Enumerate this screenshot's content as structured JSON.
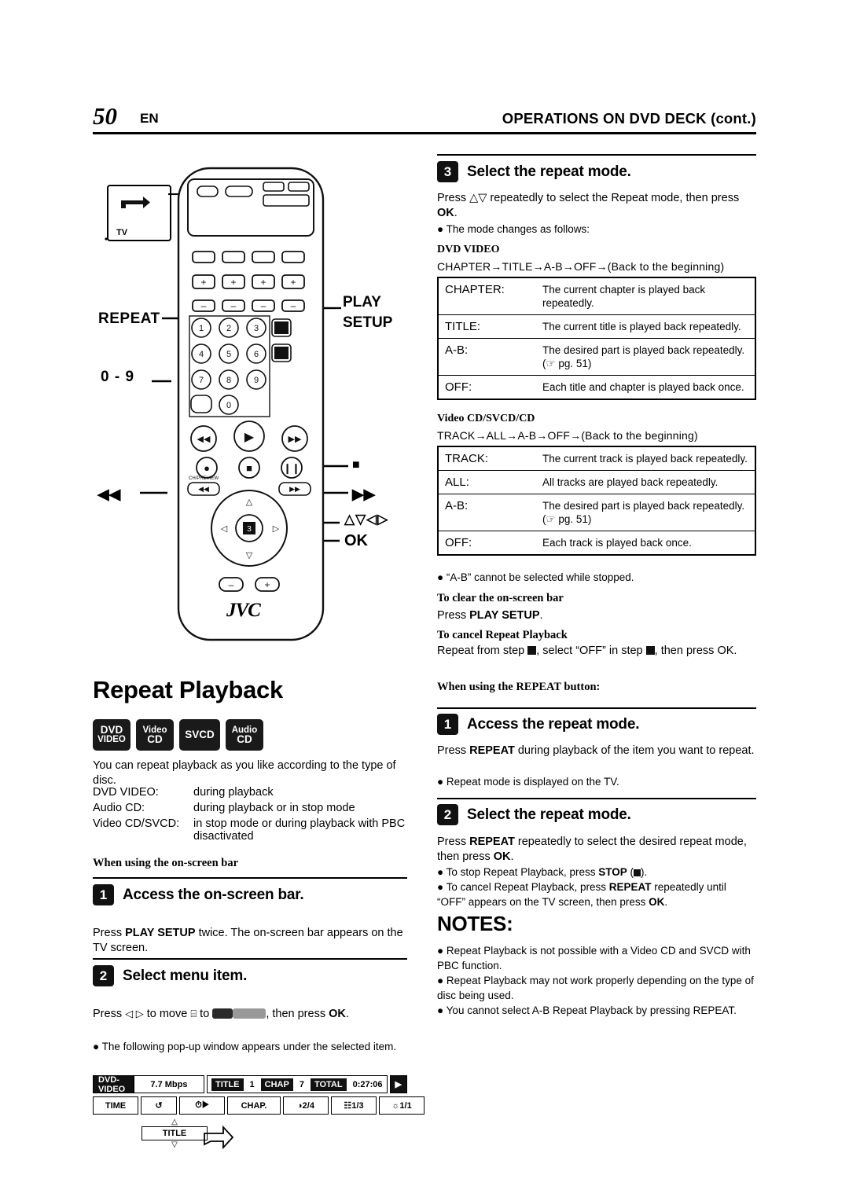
{
  "header": {
    "page_number": "50",
    "page_lang": "EN",
    "title": "OPERATIONS ON DVD DECK (cont.)"
  },
  "remote": {
    "tv_label": "TV",
    "repeat_label": "REPEAT",
    "play_label": "PLAY",
    "setup_label": "SETUP",
    "numeric_label": "0 - 9",
    "arrows_label": "△▽◁▷",
    "ok_label": "OK",
    "brand": "JVC",
    "keys": [
      "1",
      "2",
      "3",
      "4",
      "5",
      "6",
      "7",
      "8",
      "9",
      "0"
    ],
    "preview_label": "CH/PREVIEW"
  },
  "left": {
    "section_title": "Repeat Playback",
    "disc_badges": [
      {
        "l1": "DVD",
        "l2": "VIDEO"
      },
      {
        "l1": "Video",
        "l2": "CD"
      },
      {
        "l1": "SVCD",
        "l2": ""
      },
      {
        "l1": "Audio",
        "l2": "CD"
      }
    ],
    "intro": "You can repeat playback as you like according to the type of disc.",
    "disc_list": [
      {
        "term": "DVD VIDEO:",
        "desc": "during playback"
      },
      {
        "term": "Audio CD:",
        "desc": "during playback or in stop mode"
      },
      {
        "term": "Video CD/SVCD:",
        "desc": "in stop mode or during playback with PBC disactivated"
      }
    ],
    "subhead_onscreen": "When using the on-screen bar",
    "step1": {
      "num": "1",
      "title": "Access the on-screen bar.",
      "body": "Press PLAY SETUP twice. The on-screen bar appears on the TV screen."
    },
    "step2": {
      "num": "2",
      "title": "Select menu item.",
      "body_pre": "Press ",
      "body_arrows": "◁ ▷",
      "body_mid": " to move ",
      "body_cursor": "⬚",
      "body_to": " to ",
      "body_post": ", then press OK.",
      "bullet": "The following pop-up window appears under the selected item."
    },
    "onscreen_bar": {
      "label_dvdvideo": "DVD-VIDEO",
      "bitrate": "7.7 Mbps",
      "title_key": "TITLE",
      "title_val": "1",
      "chap_key": "CHAP",
      "chap_val": "7",
      "total_key": "TOTAL",
      "total_val": "0:27:06",
      "time_key": "TIME",
      "chap_btn": "CHAP.",
      "audio": "2/4",
      "subtitle": "1/3",
      "angle": "1/1",
      "popup": "TITLE"
    }
  },
  "right": {
    "step3": {
      "num": "3",
      "title": "Select the repeat mode.",
      "body": "Press △▽ repeatedly to select the Repeat mode, then press OK.",
      "bullet": "The mode changes as follows:"
    },
    "dvd_video_head": "DVD VIDEO",
    "dvd_video_flow": "CHAPTER→TITLE→A-B→OFF→(Back to the beginning)",
    "dvd_table": [
      {
        "k": "CHAPTER:",
        "v": "The current chapter is played back repeatedly."
      },
      {
        "k": "TITLE:",
        "v": "The current title is played back repeatedly."
      },
      {
        "k": "A-B:",
        "v": "The desired part is played back repeatedly. (☞ pg. 51)"
      },
      {
        "k": "OFF:",
        "v": "Each title and chapter is played back once."
      }
    ],
    "vcd_head": "Video CD/SVCD/CD",
    "vcd_flow": "TRACK→ALL→A-B→OFF→(Back to the beginning)",
    "vcd_table": [
      {
        "k": "TRACK:",
        "v": "The current track is played back repeatedly."
      },
      {
        "k": "ALL:",
        "v": "All tracks are played back repeatedly."
      },
      {
        "k": "A-B:",
        "v": "The desired part is played back repeatedly. (☞ pg. 51)"
      },
      {
        "k": "OFF:",
        "v": "Each track is played back once."
      }
    ],
    "bullet_ab": "“A-B” cannot be selected while stopped.",
    "clear_head": "To clear the on-screen bar",
    "clear_body": "Press PLAY SETUP.",
    "cancel_head": "To cancel Repeat Playback",
    "cancel_body_pre": "Repeat from step ",
    "cancel_step1": "1",
    "cancel_body_mid": ", select “OFF” in step ",
    "cancel_step3": "3",
    "cancel_body_post": ", then press OK.",
    "repeat_button_head": "When using the REPEAT button:",
    "step1": {
      "num": "1",
      "title": "Access the repeat mode.",
      "body": "Press REPEAT during playback of the item you want to repeat.",
      "bullet": "Repeat mode is displayed on the TV."
    },
    "step2": {
      "num": "2",
      "title": "Select the repeat mode.",
      "body": "Press REPEAT repeatedly to select the desired repeat mode, then press OK.",
      "bullet1": "To stop Repeat Playback, press STOP (■).",
      "bullet2": "To cancel Repeat Playback, press REPEAT repeatedly until “OFF” appears on the TV screen, then press OK."
    },
    "notes_head": "NOTES:",
    "notes": [
      "Repeat Playback is not possible with a Video CD and SVCD with PBC function.",
      "Repeat Playback may not work properly depending on the type of disc being used.",
      "You cannot select A-B Repeat Playback by pressing REPEAT."
    ]
  }
}
